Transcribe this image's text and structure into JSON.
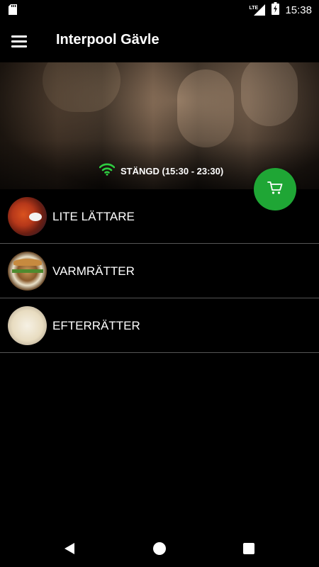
{
  "status_bar": {
    "time": "15:38",
    "network": "LTE",
    "icons": [
      "sd-card-icon",
      "lte-signal-icon",
      "battery-charging-icon"
    ]
  },
  "app_bar": {
    "title": "Interpool Gävle",
    "menu_icon": "hamburger-menu-icon"
  },
  "hero": {
    "status_text": "STÄNGD (15:30 - 23:30)",
    "status_icon": "wifi-icon",
    "status_icon_color": "#2ecc40"
  },
  "cart_button": {
    "icon": "cart-icon",
    "color": "#1fa635"
  },
  "categories": [
    {
      "label": "LITE LÄTTARE",
      "image": "chicken-wings"
    },
    {
      "label": "VARMRÄTTER",
      "image": "burger"
    },
    {
      "label": "EFTERRÄTTER",
      "image": "ice-cream"
    }
  ],
  "nav_bar": {
    "icons": [
      "back-icon",
      "home-icon",
      "recent-apps-icon"
    ]
  }
}
